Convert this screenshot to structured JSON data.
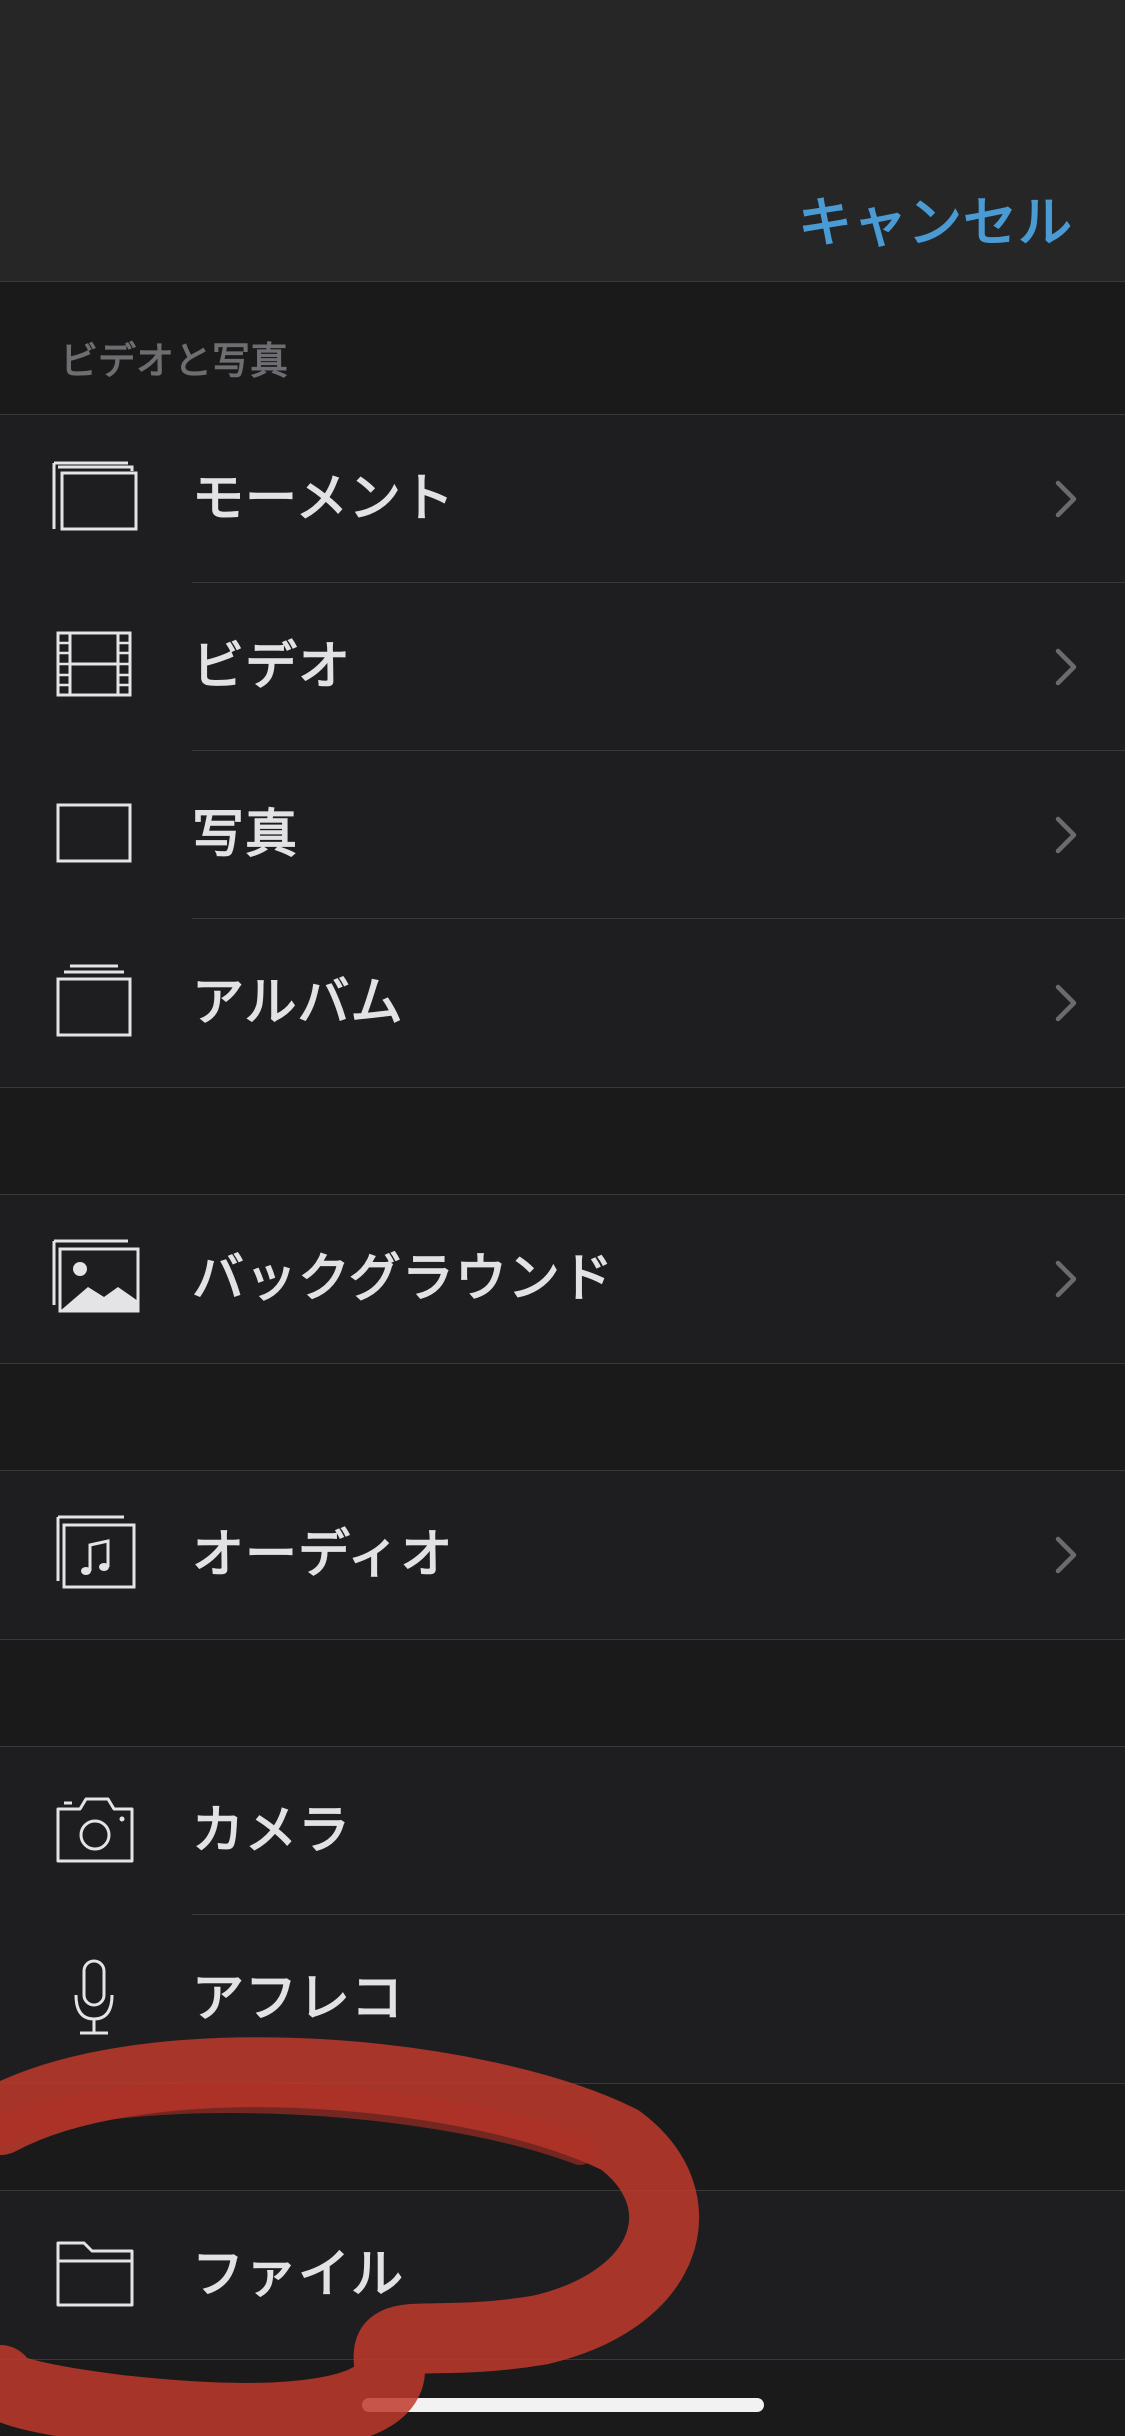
{
  "header": {
    "cancel_label": "キャンセル"
  },
  "section": {
    "title": "ビデオと写真"
  },
  "groups": {
    "media": [
      {
        "label": "モーメント",
        "icon": "moments-icon"
      },
      {
        "label": "ビデオ",
        "icon": "film-icon"
      },
      {
        "label": "写真",
        "icon": "photo-icon"
      },
      {
        "label": "アルバム",
        "icon": "album-icon"
      }
    ],
    "background": [
      {
        "label": "バックグラウンド",
        "icon": "background-image-icon"
      }
    ],
    "audio": [
      {
        "label": "オーディオ",
        "icon": "audio-music-icon"
      }
    ],
    "capture": [
      {
        "label": "カメラ",
        "icon": "camera-icon"
      },
      {
        "label": "アフレコ",
        "icon": "microphone-icon"
      }
    ],
    "files": [
      {
        "label": "ファイル",
        "icon": "folder-icon"
      }
    ]
  },
  "annotation": {
    "color": "#c0392b"
  }
}
